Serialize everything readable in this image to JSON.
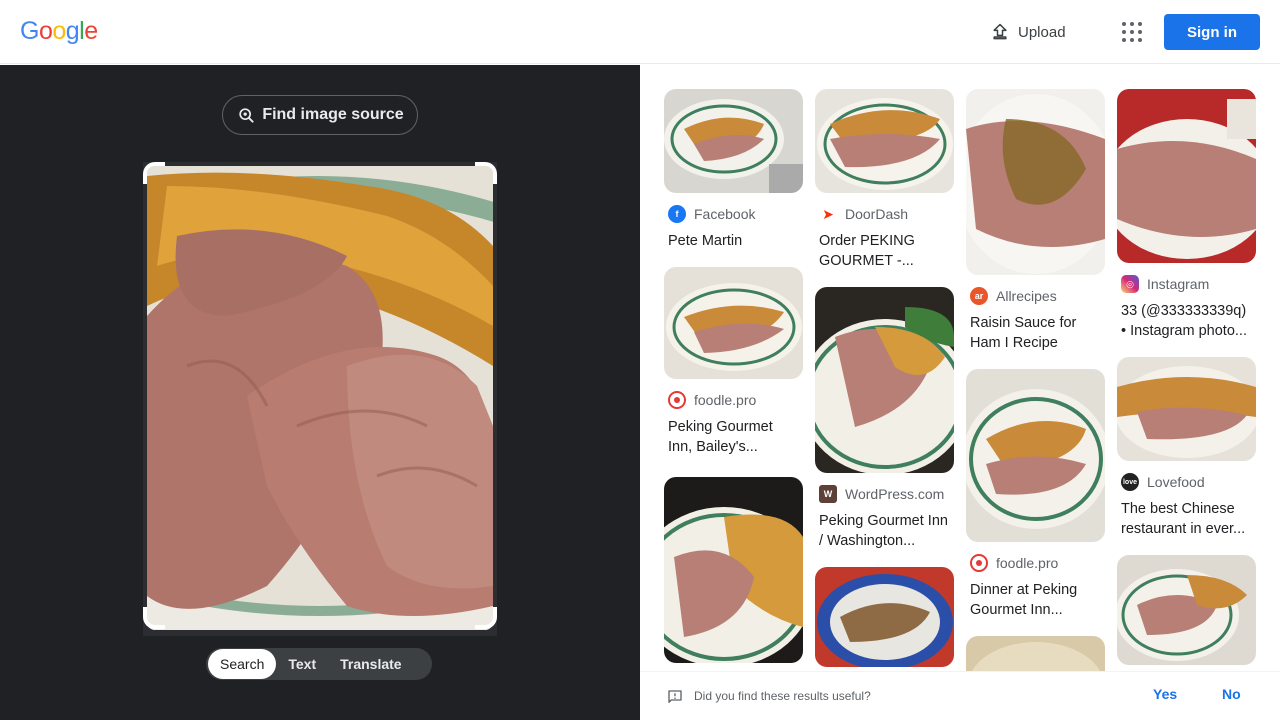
{
  "header": {
    "logo_letters": [
      {
        "ch": "G",
        "color": "#4285F4"
      },
      {
        "ch": "o",
        "color": "#EA4335"
      },
      {
        "ch": "o",
        "color": "#FBBC05"
      },
      {
        "ch": "g",
        "color": "#4285F4"
      },
      {
        "ch": "l",
        "color": "#34A853"
      },
      {
        "ch": "e",
        "color": "#EA4335"
      }
    ],
    "upload_label": "Upload",
    "apps_icon": "apps-grid-icon",
    "signin_label": "Sign in"
  },
  "left_panel": {
    "find_source_label": "Find image source",
    "modes": [
      {
        "label": "Search",
        "active": true
      },
      {
        "label": "Text",
        "active": false
      },
      {
        "label": "Translate",
        "active": false
      }
    ]
  },
  "results": {
    "col1": [
      {
        "source": "Facebook",
        "title": "Pete Martin",
        "fav": "facebook",
        "favcolor": "#1877F2"
      },
      {
        "source": "foodle.pro",
        "title": "Peking Gourmet Inn, Bailey's...",
        "fav": "foodle",
        "favcolor": "#e53935"
      },
      {
        "source": "",
        "title": "",
        "fav": "",
        "favcolor": ""
      }
    ],
    "col2": [
      {
        "source": "DoorDash",
        "title": "Order PEKING GOURMET -...",
        "fav": "doordash",
        "favcolor": "#FF3008"
      },
      {
        "source": "WordPress.com",
        "title": "Peking Gourmet Inn / Washington...",
        "fav": "wordpress",
        "favcolor": "#5d4037"
      },
      {
        "source": "",
        "title": "",
        "fav": "",
        "favcolor": ""
      }
    ],
    "col3": [
      {
        "source": "Allrecipes",
        "title": "Raisin Sauce for Ham I Recipe",
        "fav": "allrecipes",
        "favcolor": "#E8562A"
      },
      {
        "source": "foodle.pro",
        "title": "Dinner at Peking Gourmet Inn...",
        "fav": "foodle",
        "favcolor": "#e53935"
      },
      {
        "source": "",
        "title": "",
        "fav": "",
        "favcolor": ""
      }
    ],
    "col4": [
      {
        "source": "Instagram",
        "title": "33 (@333333339q) • Instagram photo...",
        "fav": "instagram",
        "favcolor": "#d62976"
      },
      {
        "source": "Lovefood",
        "title": "The best Chinese restaurant in ever...",
        "fav": "lovefood",
        "favcolor": "#222222"
      },
      {
        "source": "",
        "title": "",
        "fav": "",
        "favcolor": ""
      }
    ]
  },
  "feedback": {
    "question": "Did you find these results useful?",
    "yes_label": "Yes",
    "no_label": "No"
  }
}
